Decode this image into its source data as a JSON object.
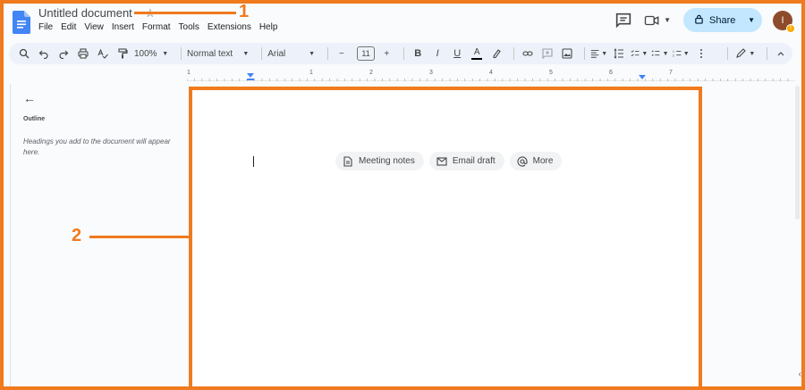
{
  "header": {
    "doc_title": "Untitled document",
    "menu": [
      "File",
      "Edit",
      "View",
      "Insert",
      "Format",
      "Tools",
      "Extensions",
      "Help"
    ],
    "share_label": "Share",
    "avatar_initial": "I",
    "avatar_badge": "!"
  },
  "toolbar": {
    "zoom": "100%",
    "style": "Normal text",
    "font": "Arial",
    "font_size": "11",
    "minus": "−",
    "plus": "+",
    "bold": "B",
    "italic": "I",
    "underline": "U",
    "text_color": "A"
  },
  "ruler": {
    "numbers": [
      "1",
      "1",
      "2",
      "3",
      "4",
      "5",
      "6",
      "7"
    ]
  },
  "outline": {
    "back": "←",
    "label": "Outline",
    "hint": "Headings you add to the document will appear here."
  },
  "page": {
    "chips": [
      "Meeting notes",
      "Email draft",
      "More"
    ]
  },
  "annotations": {
    "label_1": "1",
    "label_2": "2"
  },
  "colors": {
    "accent_orange": "#f07a1e",
    "share_bg": "#c2e7ff",
    "toolbar_bg": "#edf2fa",
    "docs_blue": "#4285f4"
  }
}
